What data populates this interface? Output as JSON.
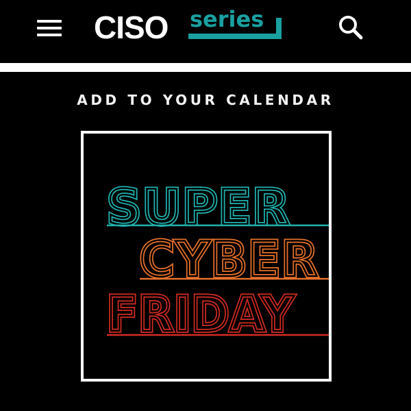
{
  "header": {
    "logo": {
      "primary": "CISO",
      "secondary": "series"
    },
    "menu_icon": "hamburger-menu-icon",
    "search_icon": "search-icon"
  },
  "main": {
    "calendar_heading": "ADD TO YOUR CALENDAR",
    "promo": {
      "lines": [
        "SUPER",
        "CYBER",
        "FRIDAY"
      ],
      "colors": {
        "super": "#1fb3b0",
        "cyber": "#e8712a",
        "friday": "#d62b22"
      },
      "image_alt": "Super Cyber Friday"
    }
  },
  "colors": {
    "background": "#000000",
    "accent": "#1aa0a0",
    "text": "#ffffff"
  }
}
